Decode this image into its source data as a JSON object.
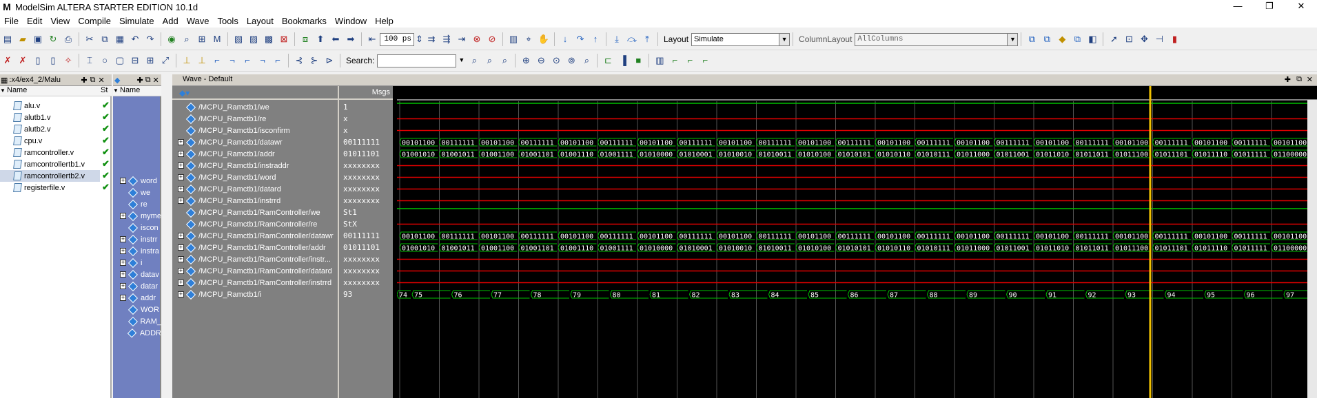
{
  "app": {
    "title": "ModelSim ALTERA STARTER EDITION 10.1d",
    "logo": "M",
    "minimize": "—",
    "maximize": "❐",
    "close": "✕"
  },
  "menu": [
    "File",
    "Edit",
    "View",
    "Compile",
    "Simulate",
    "Add",
    "Wave",
    "Tools",
    "Layout",
    "Bookmarks",
    "Window",
    "Help"
  ],
  "toolbar": {
    "time_step": "100 ps",
    "layout_label": "Layout",
    "layout_value": "Simulate",
    "columnlayout_label": "ColumnLayout",
    "columnlayout_value": "AllColumns",
    "search_label": "Search:",
    "search_value": ""
  },
  "project_pane": {
    "title": ":x4/ex4_2/Malu",
    "col_name": "Name",
    "col_status": "St",
    "files": [
      {
        "name": "alu.v",
        "status": "✔"
      },
      {
        "name": "alutb1.v",
        "status": "✔"
      },
      {
        "name": "alutb2.v",
        "status": "✔"
      },
      {
        "name": "cpu.v",
        "status": "✔"
      },
      {
        "name": "ramcontroller.v",
        "status": "✔"
      },
      {
        "name": "ramcontrollertb1.v",
        "status": "✔"
      },
      {
        "name": "ramcontrollertb2.v",
        "status": "✔"
      },
      {
        "name": "registerfile.v",
        "status": "✔"
      }
    ]
  },
  "objects_pane": {
    "col_name": "Name",
    "items": [
      {
        "name": "word",
        "expandable": true
      },
      {
        "name": "we",
        "expandable": false
      },
      {
        "name": "re",
        "expandable": false
      },
      {
        "name": "myme",
        "expandable": true
      },
      {
        "name": "iscon",
        "expandable": false
      },
      {
        "name": "instrr",
        "expandable": true
      },
      {
        "name": "instra",
        "expandable": true
      },
      {
        "name": "i",
        "expandable": true
      },
      {
        "name": "datav",
        "expandable": true
      },
      {
        "name": "datar",
        "expandable": true
      },
      {
        "name": "addr",
        "expandable": true
      },
      {
        "name": "WOR",
        "expandable": false
      },
      {
        "name": "RAM_",
        "expandable": false
      },
      {
        "name": "ADDR",
        "expandable": false
      }
    ]
  },
  "wave": {
    "title": "Wave - Default",
    "msgs_label": "Msgs",
    "signals": [
      {
        "name": "/MCPU_Ramctb1/we",
        "value": "1",
        "expandable": false
      },
      {
        "name": "/MCPU_Ramctb1/re",
        "value": "x",
        "expandable": false
      },
      {
        "name": "/MCPU_Ramctb1/isconfirm",
        "value": "x",
        "expandable": false
      },
      {
        "name": "/MCPU_Ramctb1/datawr",
        "value": "00111111",
        "expandable": true
      },
      {
        "name": "/MCPU_Ramctb1/addr",
        "value": "01011101",
        "expandable": true
      },
      {
        "name": "/MCPU_Ramctb1/instraddr",
        "value": "xxxxxxxx",
        "expandable": true
      },
      {
        "name": "/MCPU_Ramctb1/word",
        "value": "xxxxxxxx",
        "expandable": true
      },
      {
        "name": "/MCPU_Ramctb1/datard",
        "value": "xxxxxxxx",
        "expandable": true
      },
      {
        "name": "/MCPU_Ramctb1/instrrd",
        "value": "xxxxxxxx",
        "expandable": true
      },
      {
        "name": "/MCPU_Ramctb1/RamController/we",
        "value": "St1",
        "expandable": false
      },
      {
        "name": "/MCPU_Ramctb1/RamController/re",
        "value": "StX",
        "expandable": false
      },
      {
        "name": "/MCPU_Ramctb1/RamController/datawr",
        "value": "00111111",
        "expandable": true
      },
      {
        "name": "/MCPU_Ramctb1/RamController/addr",
        "value": "01011101",
        "expandable": true
      },
      {
        "name": "/MCPU_Ramctb1/RamController/instr...",
        "value": "xxxxxxxx",
        "expandable": true
      },
      {
        "name": "/MCPU_Ramctb1/RamController/datard",
        "value": "xxxxxxxx",
        "expandable": true
      },
      {
        "name": "/MCPU_Ramctb1/RamController/instrrd",
        "value": "xxxxxxxx",
        "expandable": true
      },
      {
        "name": "/MCPU_Ramctb1/i",
        "value": "93",
        "expandable": true
      }
    ],
    "datawr_values": [
      "00101100",
      "00111111",
      "00101100",
      "00111111",
      "00101100",
      "00111111",
      "00101100",
      "00111111",
      "00101100",
      "00111111",
      "00101100",
      "00111111",
      "00101100",
      "00111111",
      "00101100",
      "00111111",
      "00101100",
      "00111111",
      "00101100",
      "00111111",
      "00101100",
      "00111111",
      "00101100"
    ],
    "addr_values": [
      "01001010",
      "01001011",
      "01001100",
      "01001101",
      "01001110",
      "01001111",
      "01010000",
      "01010001",
      "01010010",
      "01010011",
      "01010100",
      "01010101",
      "01010110",
      "01010111",
      "01011000",
      "01011001",
      "01011010",
      "01011011",
      "01011100",
      "01011101",
      "01011110",
      "01011111",
      "01100000"
    ],
    "i_values": [
      "74",
      "75",
      "76",
      "77",
      "78",
      "79",
      "80",
      "81",
      "82",
      "83",
      "84",
      "85",
      "86",
      "87",
      "88",
      "89",
      "90",
      "91",
      "92",
      "93",
      "94",
      "95",
      "96",
      "97"
    ],
    "colors": {
      "green": "#00c000",
      "red": "#e00000",
      "cursor": "#f0c000",
      "text": "#ffffff"
    }
  }
}
